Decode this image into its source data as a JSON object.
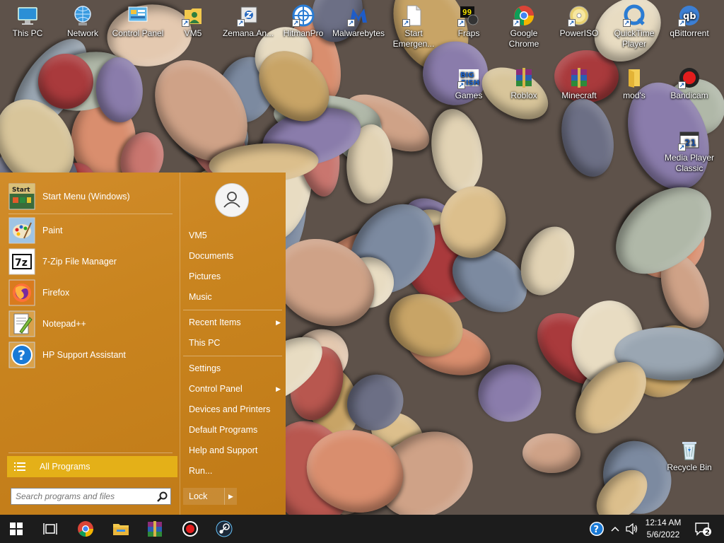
{
  "desktop": {
    "icons": [
      {
        "label": "This PC",
        "icon": "computer-icon"
      },
      {
        "label": "Network",
        "icon": "network-icon"
      },
      {
        "label": "Control Panel",
        "icon": "control-panel-icon"
      },
      {
        "label": "VM5",
        "icon": "user-folder-icon"
      },
      {
        "label": "Zemana.An...",
        "icon": "zemana-installer-icon"
      },
      {
        "label": "HitmanPro",
        "icon": "hitmanpro-icon"
      },
      {
        "label": "Malwarebytes",
        "icon": "malwarebytes-icon"
      },
      {
        "label": "Start Emergen...",
        "icon": "document-icon"
      },
      {
        "label": "Fraps",
        "icon": "fraps-icon"
      },
      {
        "label": "Google Chrome",
        "icon": "chrome-icon"
      },
      {
        "label": "PowerISO",
        "icon": "poweriso-icon"
      },
      {
        "label": "QuickTime Player",
        "icon": "quicktime-icon"
      },
      {
        "label": "qBittorrent",
        "icon": "qbittorrent-icon"
      },
      {
        "label": "Games",
        "icon": "bigfish-games-icon"
      },
      {
        "label": "Roblox",
        "icon": "winrar-archive-icon"
      },
      {
        "label": "Minecraft",
        "icon": "winrar-archive-icon"
      },
      {
        "label": "mod's",
        "icon": "folder-icon"
      },
      {
        "label": "Bandicam",
        "icon": "bandicam-icon"
      },
      {
        "label": "Media Player Classic",
        "icon": "media-player-classic-icon"
      },
      {
        "label": "Recycle Bin",
        "icon": "recycle-bin-icon"
      }
    ]
  },
  "start_menu": {
    "header_item": {
      "label": "Start Menu (Windows)",
      "icon": "start-menu-icon",
      "icon_text": "Start"
    },
    "programs": [
      {
        "label": "Paint",
        "icon": "paint-icon"
      },
      {
        "label": "7-Zip File Manager",
        "icon": "7zip-icon",
        "icon_text": "7z"
      },
      {
        "label": "Firefox",
        "icon": "firefox-icon"
      },
      {
        "label": "Notepad++",
        "icon": "notepadpp-icon"
      },
      {
        "label": "HP Support Assistant",
        "icon": "help-icon",
        "icon_text": "?"
      }
    ],
    "all_programs": "All Programs",
    "search_placeholder": "Search programs and files",
    "right_items": [
      {
        "label": "VM5",
        "arrow": false
      },
      {
        "label": "Documents",
        "arrow": false
      },
      {
        "label": "Pictures",
        "arrow": false
      },
      {
        "label": "Music",
        "arrow": false
      },
      {
        "label": "Recent Items",
        "arrow": true
      },
      {
        "label": "This PC",
        "arrow": false
      },
      {
        "label": "Settings",
        "arrow": false
      },
      {
        "label": "Control Panel",
        "arrow": true
      },
      {
        "label": "Devices and Printers",
        "arrow": false
      },
      {
        "label": "Default Programs",
        "arrow": false
      },
      {
        "label": "Help and Support",
        "arrow": false
      },
      {
        "label": "Run...",
        "arrow": false
      }
    ],
    "lock_label": "Lock",
    "accent": "#e4b018",
    "background": "#c9841f"
  },
  "taskbar": {
    "apps": [
      "windows-start-icon",
      "task-view-icon",
      "chrome-icon",
      "file-explorer-icon",
      "winrar-icon",
      "bandicam-icon",
      "steam-icon"
    ],
    "tray": {
      "help_icon_text": "?",
      "time": "12:14 AM",
      "date": "5/6/2022",
      "notification_count": "2"
    },
    "background": "#1c1c1c"
  }
}
